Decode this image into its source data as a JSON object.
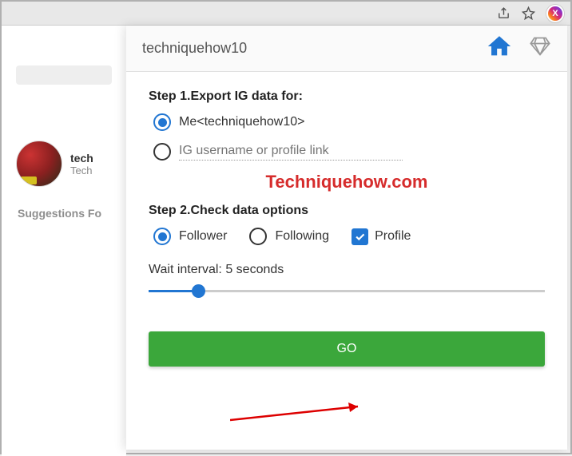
{
  "toolbar": {},
  "background": {
    "profile_user": "tech",
    "profile_name": "Tech",
    "suggestions_label": "Suggestions Fo"
  },
  "popup": {
    "username": "techniquehow10",
    "step1": {
      "heading": "Step 1.Export IG data for:",
      "me_label": "Me<techniquehow10>",
      "input_placeholder": "IG username or profile link"
    },
    "watermark": "Techniquehow.com",
    "step2": {
      "heading": "Step 2.Check data options",
      "follower_label": "Follower",
      "following_label": "Following",
      "profile_label": "Profile"
    },
    "wait": {
      "label": "Wait interval: 5 seconds"
    },
    "go_label": "GO"
  }
}
